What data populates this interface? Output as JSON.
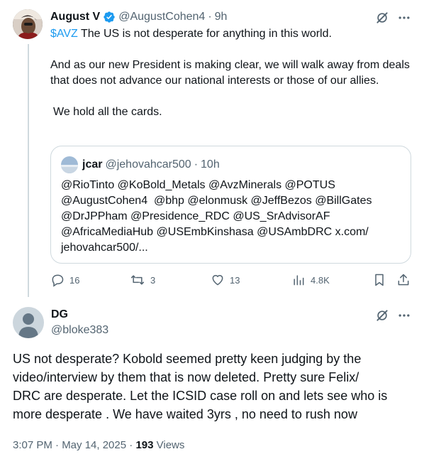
{
  "original_post": {
    "author_name": "August V",
    "author_handle": "@AugustCohen4",
    "separator": "·",
    "time_ago": "9h",
    "cashtag": "$AVZ",
    "line1_rest": " The US is not desperate for anything in this world.",
    "paragraph2": "And as our new President is making clear, we will walk away from deals that does not advance our national interests or those of our allies.",
    "paragraph3": "We hold all the cards.",
    "quote": {
      "author_name": "jcar",
      "author_handle": "@jehovahcar500",
      "separator": "·",
      "time_ago": "10h",
      "lines": [
        "@RioTinto @KoBold_Metals @AvzMinerals @POTUS",
        "@AugustCohen4  @bhp @elonmusk @JeffBezos @BillGates",
        "@DrJPPham @Presidence_RDC @US_SrAdvisorAF",
        "@AfricaMediaHub @USEmbKinshasa @USAmbDRC x.com/",
        "jehovahcar500/..."
      ]
    },
    "actions": {
      "replies": "16",
      "reposts": "3",
      "likes": "13",
      "views": "4.8K"
    }
  },
  "reply_post": {
    "author_name": "DG",
    "author_handle": "@bloke383",
    "body_lines": [
      "US not desperate? Kobold seemed pretty keen judging by the",
      "video/interview by them that is now deleted. Pretty sure Felix/",
      "DRC are desperate. Let the ICSID case roll on and lets see who is",
      "more desperate . We have waited 3yrs , no need to rush now"
    ],
    "timestamp": "3:07 PM · May 14, 2025",
    "dot": " · ",
    "views_count": "193",
    "views_label": " Views"
  },
  "colors": {
    "accent": "#1d9bf0",
    "muted": "#536471",
    "text": "#0f1419",
    "border": "#cfd9de"
  }
}
